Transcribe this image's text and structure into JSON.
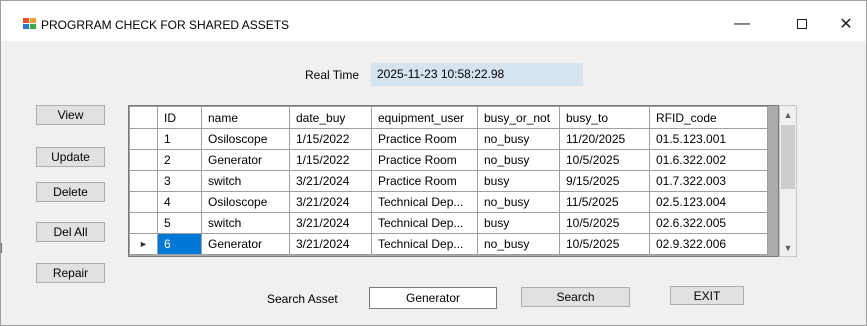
{
  "window": {
    "title": "PROGRRAM CHECK FOR SHARED ASSETS",
    "minimize_glyph": "—",
    "close_glyph": "✕",
    "icon": "windows-form-icon"
  },
  "realtime": {
    "label": "Real Time",
    "value": "2025-11-23 10:58:22.98"
  },
  "side_buttons": {
    "view": "View",
    "update": "Update",
    "delete": "Delete",
    "del_all": "Del All",
    "repair": "Repair"
  },
  "grid": {
    "columns": [
      "ID",
      "name",
      "date_buy",
      "equipment_user",
      "busy_or_not",
      "busy_to",
      "RFID_code"
    ],
    "rows": [
      [
        "1",
        "Osiloscope",
        "1/15/2022",
        "Practice Room",
        "no_busy",
        "11/20/2025",
        "01.5.123.001"
      ],
      [
        "2",
        "Generator",
        "1/15/2022",
        "Practice Room",
        "no_busy",
        "10/5/2025",
        "01.6.322.002"
      ],
      [
        "3",
        "switch",
        "3/21/2024",
        "Practice Room",
        "busy",
        "9/15/2025",
        "01.7.322.003"
      ],
      [
        "4",
        "Osiloscope",
        "3/21/2024",
        "Technical Dep...",
        "no_busy",
        "11/5/2025",
        "02.5.123.004"
      ],
      [
        "5",
        "switch",
        "3/21/2024",
        "Technical Dep...",
        "busy",
        "10/5/2025",
        "02.6.322.005"
      ],
      [
        "6",
        "Generator",
        "3/21/2024",
        "Technical Dep...",
        "no_busy",
        "10/5/2025",
        "02.9.322.006"
      ]
    ],
    "current_row_index": 5,
    "row_indicator": "►",
    "scroll_up": "▲",
    "scroll_down": "▼"
  },
  "search": {
    "label": "Search Asset",
    "value": "Generator",
    "button": "Search"
  },
  "exit_button": "EXIT",
  "colors": {
    "window_bg": "#f0f0f0",
    "realtime_bg": "#d6e4f0",
    "selection": "#0078d7",
    "grid_bg": "#ababab"
  }
}
